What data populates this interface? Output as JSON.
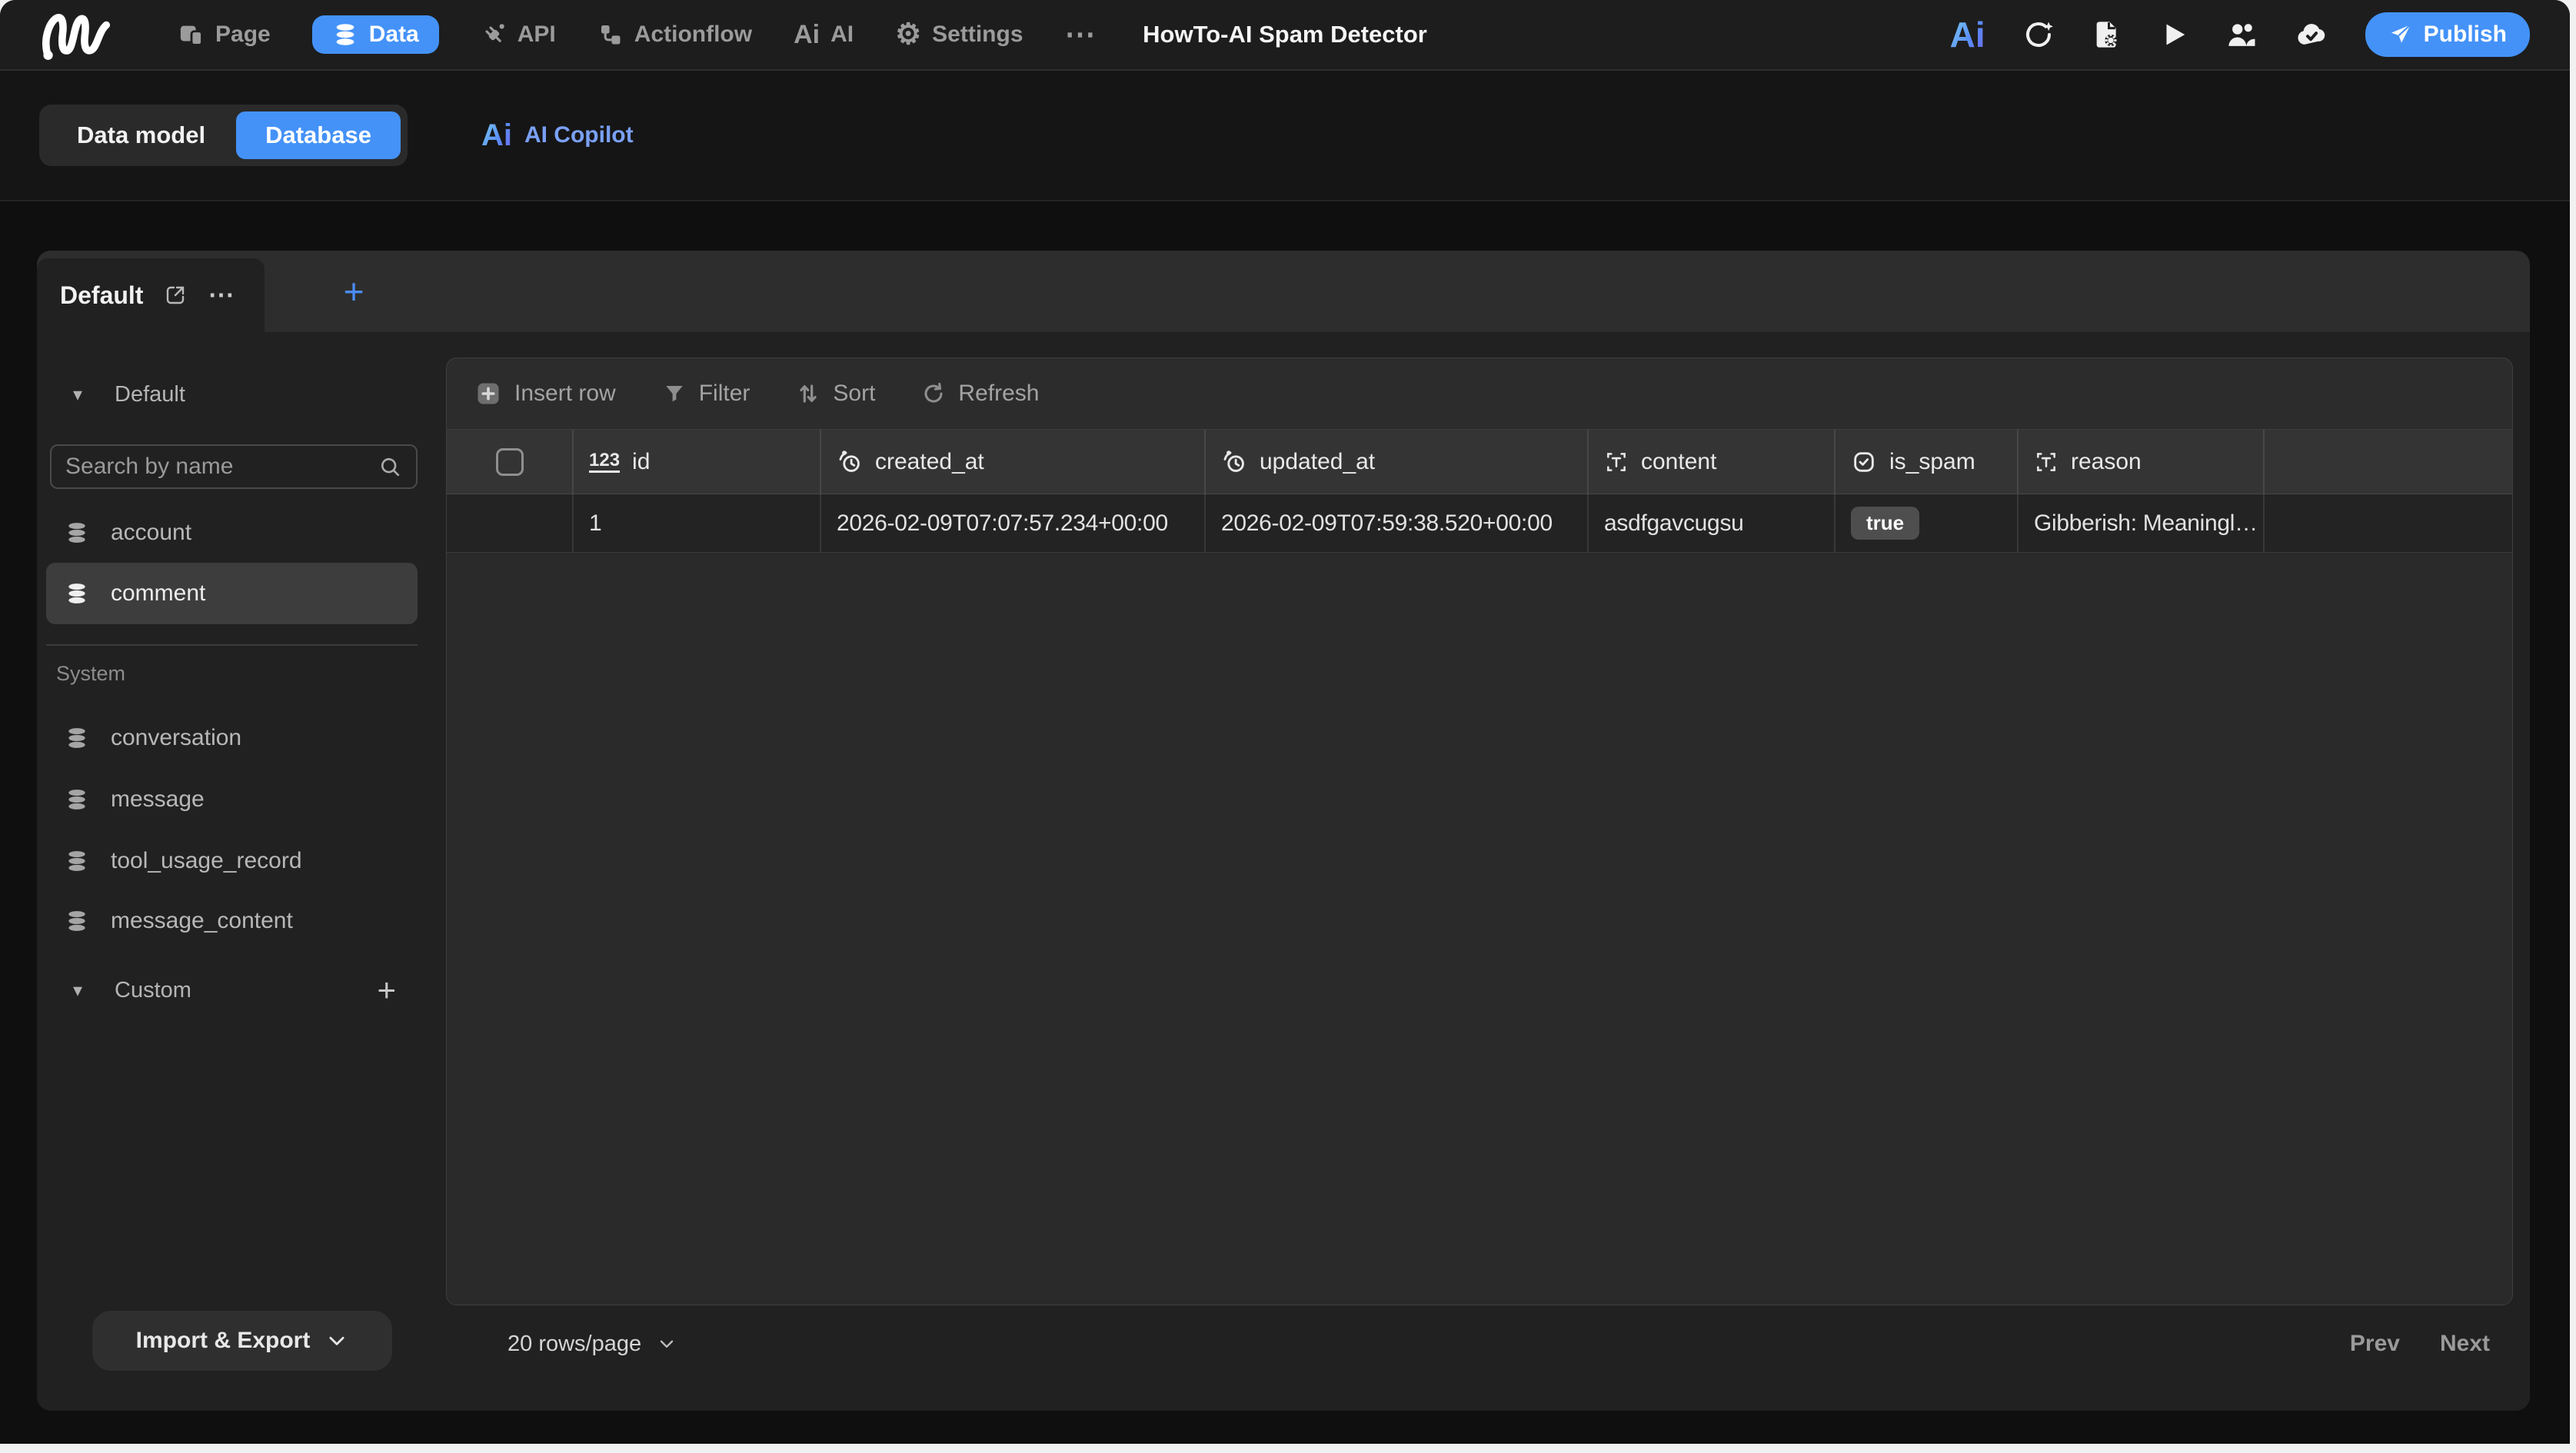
{
  "topbar": {
    "title": "HowTo-AI Spam Detector",
    "nav": [
      {
        "label": "Page"
      },
      {
        "label": "Data",
        "active": true
      },
      {
        "label": "API"
      },
      {
        "label": "Actionflow"
      },
      {
        "label": "AI"
      },
      {
        "label": "Settings"
      }
    ],
    "publish_label": "Publish"
  },
  "mode_bar": {
    "data_model_label": "Data model",
    "database_label": "Database",
    "ai_copilot_label": "AI Copilot"
  },
  "view_tabs": {
    "active_label": "Default",
    "add_label": "+"
  },
  "sidebar": {
    "group_label": "Default",
    "search_placeholder": "Search by name",
    "default_tables": [
      "account",
      "comment"
    ],
    "selected_table": "comment",
    "system_label": "System",
    "system_tables": [
      "conversation",
      "message",
      "tool_usage_record",
      "message_content"
    ],
    "custom_label": "Custom",
    "custom_add_label": "+",
    "import_export_label": "Import & Export"
  },
  "toolbar": {
    "insert_row_label": "Insert row",
    "filter_label": "Filter",
    "sort_label": "Sort",
    "refresh_label": "Refresh"
  },
  "table": {
    "columns": [
      {
        "name": "id",
        "type": "number"
      },
      {
        "name": "created_at",
        "type": "datetime"
      },
      {
        "name": "updated_at",
        "type": "datetime"
      },
      {
        "name": "content",
        "type": "text"
      },
      {
        "name": "is_spam",
        "type": "boolean"
      },
      {
        "name": "reason",
        "type": "text"
      }
    ],
    "rows": [
      {
        "id": "1",
        "created_at": "2026-02-09T07:07:57.234+00:00",
        "updated_at": "2026-02-09T07:59:38.520+00:00",
        "content": "asdfgavcugsu",
        "is_spam": "true",
        "reason": "Gibberish: Meaningl…"
      }
    ]
  },
  "pagination": {
    "rows_per_page": "20 rows/page",
    "prev_label": "Prev",
    "next_label": "Next"
  },
  "icons": {
    "gear": "⚙",
    "more": "⋯",
    "triangle_down": "▾",
    "ai_text": "Ai"
  },
  "colors": {
    "accent_blue": "#4492f8",
    "copilot_blue": "#7aa0f5",
    "badge_gray": "#4e4e4e"
  }
}
